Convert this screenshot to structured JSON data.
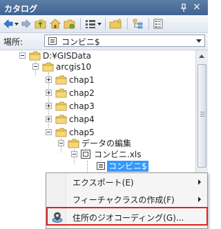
{
  "window": {
    "title": "カタログ",
    "pin_glyph": "ₜ",
    "close_glyph": "×"
  },
  "toolbar": {
    "icons": [
      "back-arrow-icon",
      "forward-arrow-icon",
      "up-folder-icon",
      "home-icon",
      "folder-connect-icon",
      "view-list-icon",
      "new-folder-icon",
      "tree-toggle-icon",
      "options-icon"
    ]
  },
  "location": {
    "label": "場所:",
    "value": "コンビニ$"
  },
  "tree": {
    "items": [
      {
        "label": "D:¥GISData"
      },
      {
        "label": "arcgis10"
      },
      {
        "label": "chap1"
      },
      {
        "label": "chap2"
      },
      {
        "label": "chap3"
      },
      {
        "label": "chap4"
      },
      {
        "label": "chap5"
      },
      {
        "label": "データの編集"
      },
      {
        "label": "コンビニ.xls"
      },
      {
        "label": "コンビニ$"
      }
    ]
  },
  "context_menu": {
    "items": [
      {
        "label": "エクスポート(E)",
        "has_submenu": true
      },
      {
        "label": "フィーチャクラスの作成(F)",
        "has_submenu": true
      },
      {
        "label": "住所のジオコーディング(G)...",
        "has_submenu": false,
        "highlighted": true
      }
    ],
    "highlight_color": "#e02020"
  },
  "colors": {
    "titlebar": "#4a6c99",
    "selection": "#3399ff",
    "folder": "#f0c75a"
  }
}
